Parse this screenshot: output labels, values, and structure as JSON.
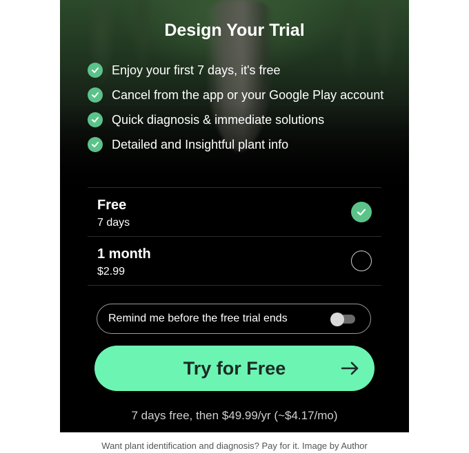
{
  "screen": {
    "title": "Design Your Trial",
    "features": [
      {
        "icon": "check-circle-icon",
        "text": "Enjoy your first 7 days, it's free"
      },
      {
        "icon": "check-circle-icon",
        "text": "Cancel from the app or your Google Play account"
      },
      {
        "icon": "check-circle-icon",
        "text": "Quick diagnosis & immediate solutions"
      },
      {
        "icon": "check-circle-icon",
        "text": "Detailed and Insightful plant info"
      }
    ],
    "plans": [
      {
        "name": "Free",
        "detail": "7 days",
        "selected": true
      },
      {
        "name": "1 month",
        "detail": "$2.99",
        "selected": false
      }
    ],
    "reminder": {
      "label": "Remind me before the free trial ends",
      "enabled": false
    },
    "cta": {
      "label": "Try for Free",
      "icon": "arrow-right-icon"
    },
    "pricing_note": "7 days free, then $49.99/yr (~$4.17/mo)"
  },
  "caption": "Want plant identification and diagnosis? Pay for it. Image by Author",
  "colors": {
    "accent": "#6cf4b3",
    "check_green": "#5bc38a",
    "background": "#000000"
  }
}
